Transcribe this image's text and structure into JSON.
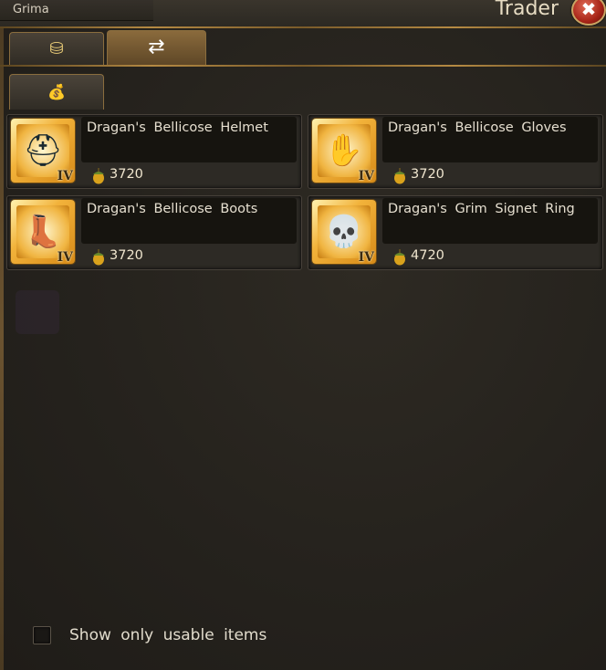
{
  "window": {
    "owner": "Grima",
    "title": "Trader",
    "close_symbol": "✖"
  },
  "tabs": [
    {
      "icon": "coins-icon",
      "symbol": "⛁",
      "active": false
    },
    {
      "icon": "exchange-arrows-icon",
      "symbol": "⇄",
      "active": true
    }
  ],
  "subtabs": [
    {
      "icon": "money-bag-icon",
      "symbol": "💰",
      "active": true
    }
  ],
  "items": [
    {
      "name": "Dragan's Bellicose Helmet",
      "price": "3720",
      "tier": "IV",
      "icon": "helmet-icon",
      "symbol": "⛑"
    },
    {
      "name": "Dragan's Bellicose Gloves",
      "price": "3720",
      "tier": "IV",
      "icon": "gloves-icon",
      "symbol": "✋"
    },
    {
      "name": "Dragan's Bellicose Boots",
      "price": "3720",
      "tier": "IV",
      "icon": "boots-icon",
      "symbol": "👢"
    },
    {
      "name": "Dragan's Grim Signet Ring",
      "price": "4720",
      "tier": "IV",
      "icon": "skull-ring-icon",
      "symbol": "💀"
    }
  ],
  "currency_icon": "acorn-icon",
  "filter": {
    "label": "Show only usable items",
    "checked": false
  },
  "colors": {
    "accent_gold": "#f2b23a",
    "panel_bg": "#24211c"
  }
}
